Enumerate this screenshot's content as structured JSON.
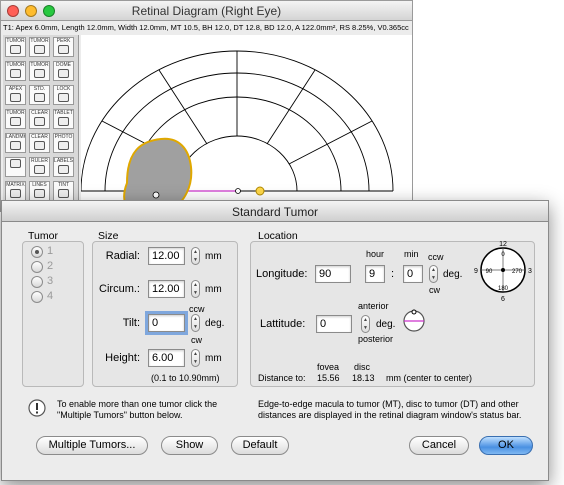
{
  "retinal_window": {
    "title": "Retinal Diagram (Right Eye)",
    "status_line": "T1: Apex 6.0mm, Length 12.0mm, Width 12.0mm, MT 10.5, BH 12.0, DT 12.8, BD 12.0, A 122.0mm², RS 8.25%, V0.365cc",
    "tools": [
      {
        "label": "TUMOR",
        "icon": "tumor-1-icon"
      },
      {
        "label": "TUMOR",
        "icon": "tumor-2-icon"
      },
      {
        "label": "PERK",
        "icon": "perk-icon"
      },
      {
        "label": "TUMOR",
        "icon": "tumor-3-icon"
      },
      {
        "label": "TUMOR",
        "icon": "tumor-4-icon"
      },
      {
        "label": "DOME",
        "icon": "dome-icon"
      },
      {
        "label": "APEX",
        "icon": "apex-icon"
      },
      {
        "label": "STD.",
        "icon": "standard-icon"
      },
      {
        "label": "LOCK",
        "icon": "lock-icon"
      },
      {
        "label": "TUMOR",
        "icon": "tumor-5-icon"
      },
      {
        "label": "CLEAR",
        "icon": "clear-icon"
      },
      {
        "label": "TABLET",
        "icon": "tablet-icon"
      },
      {
        "label": "LANDMK",
        "icon": "landmark-icon"
      },
      {
        "label": "CLEAR",
        "icon": "clear-landmark-icon"
      },
      {
        "label": "PHOTO",
        "icon": "photo-icon"
      },
      {
        "label": "",
        "icon": "right-eye-icon"
      },
      {
        "label": "RULER",
        "icon": "ruler-icon"
      },
      {
        "label": "LABELS",
        "icon": "labels-icon"
      },
      {
        "label": "MATRIX",
        "icon": "matrix-icon"
      },
      {
        "label": "LINES",
        "icon": "lines-icon"
      },
      {
        "label": "TINT",
        "icon": "tint-icon"
      }
    ]
  },
  "dialog": {
    "title": "Standard Tumor",
    "tumor_group": {
      "label": "Tumor",
      "options": [
        "1",
        "2",
        "3",
        "4"
      ],
      "selected": "1"
    },
    "size": {
      "label": "Size",
      "radial": {
        "label": "Radial:",
        "value": "12.00",
        "unit": "mm"
      },
      "circum": {
        "label": "Circum.:",
        "value": "12.00",
        "unit": "mm"
      },
      "tilt": {
        "label": "Tilt:",
        "value": "0",
        "unit": "deg.",
        "ccw": "ccw",
        "cw": "cw"
      },
      "height": {
        "label": "Height:",
        "value": "6.00",
        "unit": "mm"
      },
      "range": "(0.1 to 10.90mm)"
    },
    "location": {
      "label": "Location",
      "hour_label": "hour",
      "min_label": "min",
      "longitude": {
        "label": "Longitude:",
        "value": "90",
        "hour": "9",
        "colon": ":",
        "min": "0",
        "unit": "deg.",
        "ccw": "ccw",
        "cw": "cw"
      },
      "latitude": {
        "label": "Lattitude:",
        "value": "0",
        "unit": "deg.",
        "anterior": "anterior",
        "posterior": "posterior"
      },
      "clock": {
        "n12": "12",
        "n3": "3",
        "n6": "6",
        "n9": "9",
        "d90": "90",
        "d270": "270",
        "d0": "0",
        "d180": "180"
      },
      "distance_label": "Distance to:",
      "fovea_label": "fovea",
      "disc_label": "disc",
      "fovea_value": "15.56",
      "disc_value": "18.13",
      "distance_unit": "mm (center to center)"
    },
    "info_left": "To enable more than one tumor click the \"Multiple Tumors\" button below.",
    "info_right": "Edge-to-edge macula to tumor (MT), disc to tumor (DT) and other distances are displayed in the retinal diagram window's status bar.",
    "buttons": {
      "multiple": "Multiple Tumors...",
      "show": "Show",
      "default": "Default",
      "cancel": "Cancel",
      "ok": "OK"
    }
  },
  "colors": {
    "accent": "#4a90e2",
    "tumor_fill": "#a0a0a0",
    "tumor_outline": "#e0a800",
    "meridian": "#cc33cc"
  }
}
